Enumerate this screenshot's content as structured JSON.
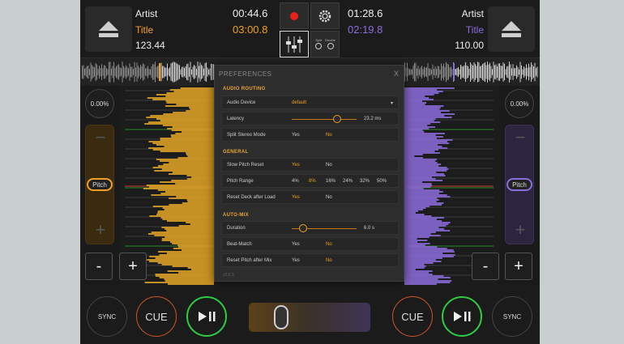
{
  "deckA": {
    "artist": "Artist",
    "title": "Title",
    "bpm": "123.44",
    "elapsed": "00:44.6",
    "remaining": "03:00.8",
    "pitch_pct": "0.00%",
    "pitch_label": "Pitch",
    "minus": "-",
    "plus": "+"
  },
  "deckB": {
    "artist": "Artist",
    "title": "Title",
    "bpm": "110.00",
    "elapsed": "01:28.6",
    "remaining": "02:19.8",
    "pitch_pct": "0.00%",
    "pitch_label": "Pitch",
    "minus": "-",
    "plus": "+"
  },
  "controls": {
    "split_label": "Split",
    "double_label": "Double"
  },
  "colors": {
    "deckA": "#f0a020",
    "deckB": "#8d6cdc",
    "record": "#e8201c",
    "play": "#2ecc40",
    "cue": "#d2552a"
  },
  "icons": [
    "eject-icon",
    "record-icon",
    "settings-gear-icon",
    "mixer-faders-icon",
    "split-icon",
    "double-icon",
    "play-pause-icon"
  ],
  "prefs": {
    "title": "PREFERENCES",
    "close": "X",
    "routing": {
      "header": "AUDIO ROUTING",
      "device_label": "Audio Device",
      "device_value": "default",
      "latency_label": "Latency",
      "latency_value": "23.2 ms",
      "latency_level": 0.7,
      "split_label": "Split Stereo Mode",
      "split_yes": "Yes",
      "split_no": "No"
    },
    "general": {
      "header": "GENERAL",
      "slow_label": "Slow Pitch Reset",
      "slow_yes": "Yes",
      "slow_no": "No",
      "range_label": "Pitch Range",
      "ranges": [
        "4%",
        "8%",
        "16%",
        "24%",
        "32%",
        "50%"
      ],
      "reset_label": "Reset Deck after Load",
      "reset_yes": "Yes",
      "reset_no": "No"
    },
    "automix": {
      "header": "AUTO-MIX",
      "duration_label": "Duration",
      "duration_value": "6.0 s",
      "duration_level": 0.18,
      "beat_label": "Beat-Match",
      "beat_yes": "Yes",
      "beat_no": "No",
      "resetmix_label": "Reset Pitch after Mix",
      "resetmix_yes": "Yes",
      "resetmix_no": "No"
    },
    "version": "v2.0.3"
  },
  "bottom": {
    "syncA": "SYNC",
    "cueA": "CUE",
    "syncB": "SYNC",
    "cueB": "CUE",
    "xfader_level": 0.25
  }
}
